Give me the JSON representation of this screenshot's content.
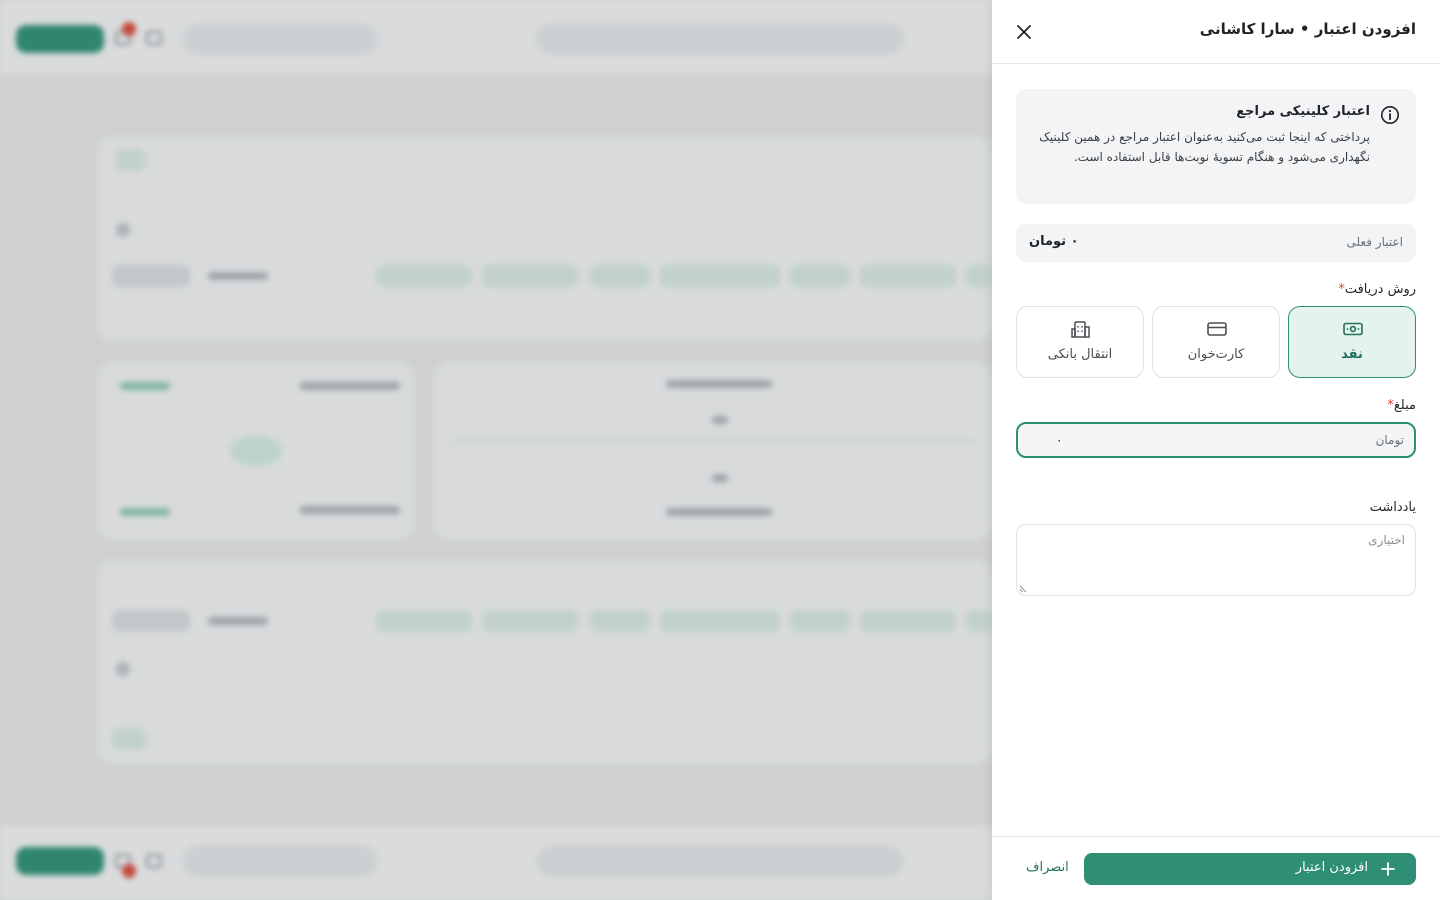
{
  "drawer": {
    "title": "افزودن اعتبار • سارا کاشانی",
    "close_icon": "close-icon"
  },
  "info": {
    "icon": "info-circle-icon",
    "title": "اعتبار کلینیکی مراجع",
    "text": "پرداختی که اینجا ثبت می‌کنید به‌عنوان اعتبار مراجع در همین کلینیک نگهداری می‌شود و هنگام تسویهٔ نوبت‌ها قابل استفاده است."
  },
  "credit": {
    "label": "اعتبار فعلی",
    "value": "۰ تومان"
  },
  "payment_method": {
    "label": "روش دریافت",
    "required_mark": "*",
    "selected": "cash",
    "options": [
      {
        "id": "cash",
        "label": "نقد",
        "icon": "cash-icon"
      },
      {
        "id": "card",
        "label": "کارت‌خوان",
        "icon": "credit-card-icon"
      },
      {
        "id": "bank",
        "label": "انتقال بانکی",
        "icon": "bank-building-icon"
      }
    ]
  },
  "amount": {
    "label": "مبلغ",
    "required_mark": "*",
    "unit": "تومان",
    "value": "۰"
  },
  "note": {
    "label": "یادداشت",
    "placeholder": "اختیاری"
  },
  "footer": {
    "submit_label": "افزودن اعتبار",
    "submit_icon": "plus-icon",
    "cancel_label": "انصراف"
  },
  "colors": {
    "primary": "#2e8f74",
    "primary_light": "#e4f3ee",
    "required": "#d9473b"
  }
}
